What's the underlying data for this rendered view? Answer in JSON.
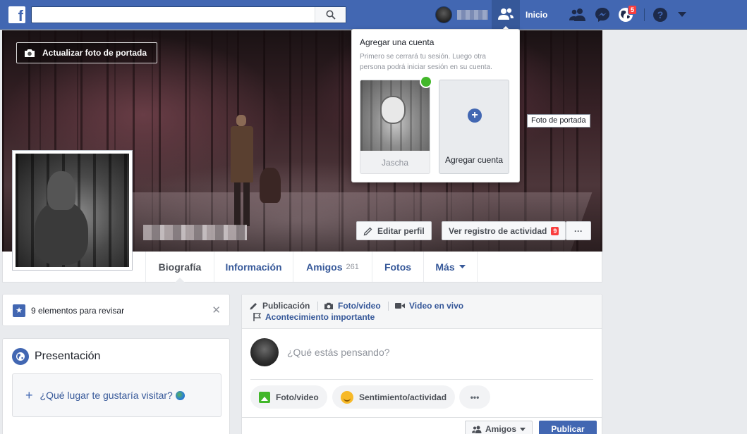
{
  "topbar": {
    "logo": "f",
    "search_value": "",
    "profile_name": "",
    "home_label": "Inicio",
    "notifications_count": "5"
  },
  "cover": {
    "update_label": "Actualizar foto de portada",
    "edit_profile_label": "Editar perfil",
    "activity_log_label": "Ver registro de actividad",
    "activity_count": "9",
    "more_label": "···",
    "tooltip": "Foto de portada"
  },
  "account_switcher": {
    "title": "Agregar una cuenta",
    "description": "Primero se cerrará tu sesión. Luego otra persona podrá iniciar sesión en su cuenta.",
    "accounts": [
      {
        "name": "Jascha",
        "online": true
      }
    ],
    "add_label": "Agregar cuenta",
    "add_icon": "+"
  },
  "profile_nav": {
    "tabs": [
      {
        "label": "Biografía",
        "active": true
      },
      {
        "label": "Información"
      },
      {
        "label": "Amigos",
        "count": "261"
      },
      {
        "label": "Fotos"
      },
      {
        "label": "Más"
      }
    ]
  },
  "review": {
    "text": "9 elementos para revisar",
    "close": "✕"
  },
  "intro": {
    "title": "Presentación",
    "place_prompt": "¿Qué lugar te gustaría visitar?"
  },
  "composer": {
    "tabs": [
      "Publicación",
      "Foto/video",
      "Video en vivo",
      "Acontecimiento importante"
    ],
    "placeholder": "¿Qué estás pensando?",
    "actions": [
      "Foto/video",
      "Sentimiento/actividad",
      "•••"
    ],
    "audience_label": "Amigos",
    "publish_label": "Publicar"
  },
  "colors": {
    "brand_blue": "#4267b2",
    "link_blue": "#365899",
    "badge_red": "#fa3e3e",
    "online_green": "#42b72a",
    "page_bg": "#e9ebee"
  }
}
